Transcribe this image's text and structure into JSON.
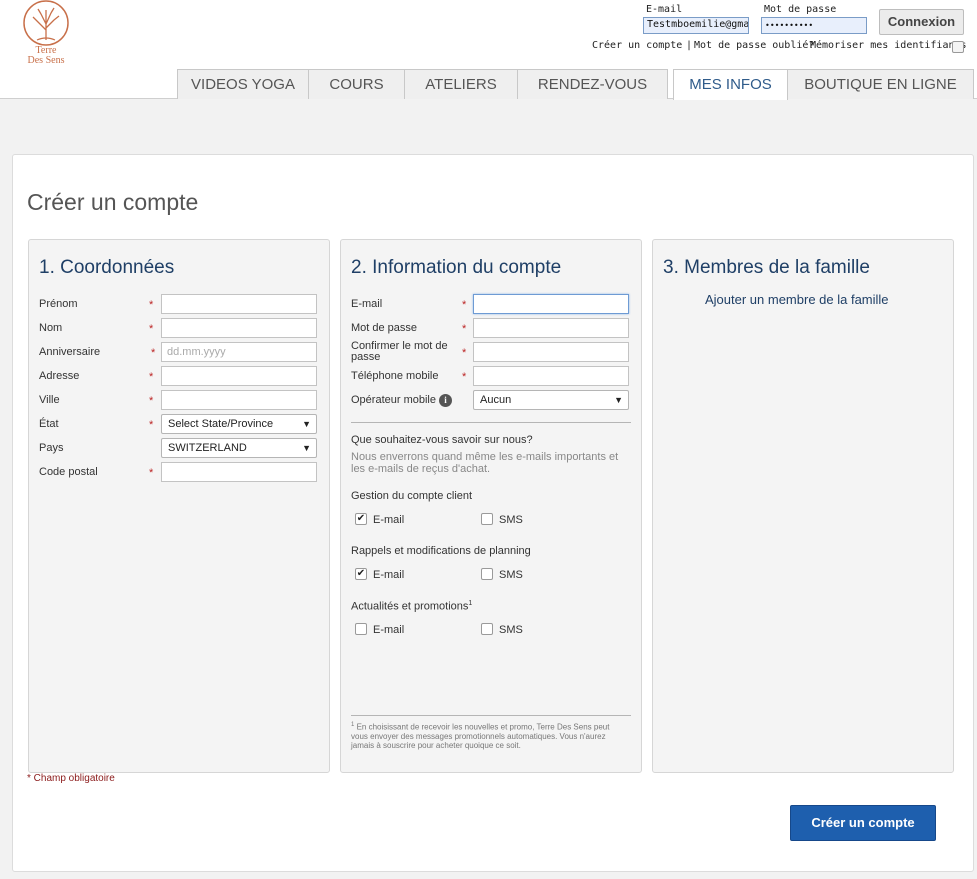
{
  "brand": {
    "name_line1": "Terre",
    "name_line2": "Des Sens",
    "accent_color": "#c8704a"
  },
  "login": {
    "email_label": "E-mail",
    "email_value": "Testmboemilie@gma",
    "password_label": "Mot de passe",
    "password_value": "••••••••••",
    "connexion_label": "Connexion",
    "create_account_link": "Créer un compte",
    "separator": "|",
    "forgot_password_link": "Mot de passe oublié?",
    "remember_label": "Mémoriser mes identifiants"
  },
  "nav": {
    "tabs": [
      {
        "label": "VIDEOS YOGA"
      },
      {
        "label": "COURS"
      },
      {
        "label": "ATELIERS"
      },
      {
        "label": "RENDEZ-VOUS"
      },
      {
        "label": "MES INFOS",
        "active": true
      },
      {
        "label": "BOUTIQUE EN LIGNE"
      }
    ]
  },
  "page": {
    "title": "Créer un compte"
  },
  "coordonnees": {
    "title": "1. Coordonnées",
    "fields": [
      {
        "label": "Prénom",
        "required": "*"
      },
      {
        "label": "Nom",
        "required": "*"
      },
      {
        "label": "Anniversaire",
        "required": "*",
        "placeholder": "dd.mm.yyyy"
      },
      {
        "label": "Adresse",
        "required": "*"
      },
      {
        "label": "Ville",
        "required": "*"
      },
      {
        "label": "État",
        "required": "*",
        "select_value": "Select State/Province"
      },
      {
        "label": "Pays",
        "select_value": "SWITZERLAND"
      },
      {
        "label": "Code postal",
        "required": "*"
      }
    ]
  },
  "compte": {
    "title": "2. Information du compte",
    "fields": [
      {
        "label": "E-mail",
        "required": "*"
      },
      {
        "label": "Mot de passe",
        "required": "*"
      },
      {
        "label": "Confirmer le mot de passe",
        "required": "*"
      },
      {
        "label": "Téléphone mobile",
        "required": "*"
      },
      {
        "label": "Opérateur mobile",
        "select_value": "Aucun"
      }
    ],
    "prefs_question": "Que souhaitez-vous savoir sur nous?",
    "prefs_note": "Nous enverrons quand même les e-mails importants et les e-mails de reçus d'achat.",
    "groups": [
      {
        "title": "Gestion du compte client",
        "email": "E-mail",
        "sms": "SMS",
        "email_checked": true,
        "sms_checked": false
      },
      {
        "title": "Rappels et modifications de planning",
        "email": "E-mail",
        "sms": "SMS",
        "email_checked": true,
        "sms_checked": false
      },
      {
        "title": "Actualités et promotions",
        "sup": "1",
        "email": "E-mail",
        "sms": "SMS",
        "email_checked": false,
        "sms_checked": false
      }
    ],
    "footnote_marker": "1",
    "footnote": "En choisissant de recevoir les nouvelles et promo, Terre Des Sens peut vous envoyer des messages promotionnels automatiques. Vous n'aurez jamais à souscrire pour acheter quoique ce soit."
  },
  "famille": {
    "title": "3. Membres de la famille",
    "add_link": "Ajouter un membre de la famille"
  },
  "required_note": "* Champ obligatoire",
  "submit_label": "Créer un compte",
  "check_glyph": "✔",
  "caret_glyph": "▼",
  "info_glyph": "i",
  "colors": {
    "primary_button": "#1e5fae",
    "heading": "#1f3f66",
    "required": "#b22222"
  }
}
